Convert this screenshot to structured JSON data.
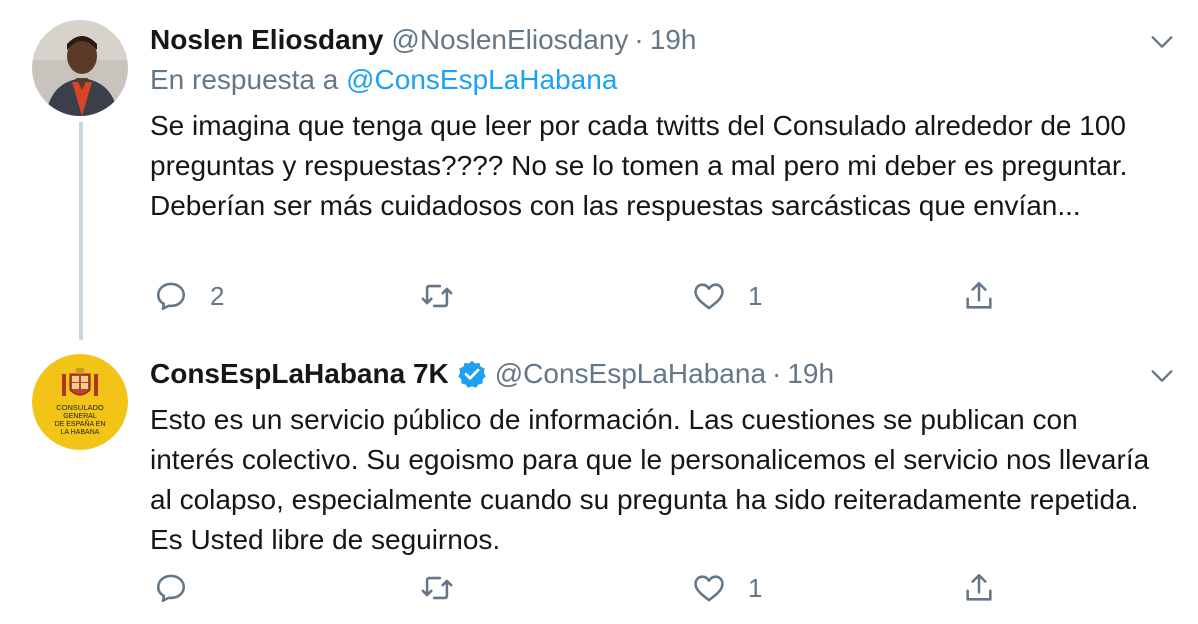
{
  "tweets": [
    {
      "name": "Noslen Eliosdany",
      "handle": "@NoslenEliosdany",
      "separator": "·",
      "time": "19h",
      "reply_prefix": "En respuesta a",
      "reply_mention": "@ConsEspLaHabana",
      "text": "Se imagina que tenga que leer por cada twitts del Consulado alrededor de 100 preguntas y respuestas???? No se lo tomen a mal pero mi deber es preguntar. Deberían ser más cuidadosos con las respuestas sarcásticas que envían...",
      "replies": "2",
      "retweets": "",
      "likes": "1",
      "avatar_icon": "user-photo-avatar"
    },
    {
      "name": "ConsEspLaHabana 7K",
      "handle": "@ConsEspLaHabana",
      "separator": "·",
      "time": "19h",
      "verified": true,
      "text": "Esto es un servicio público de información. Las cuestiones se publican con interés colectivo. Su egoismo para que le personalicemos el servicio nos llevaría al colapso, especialmente cuando su pregunta ha sido reiteradamente repetida. Es Usted libre de seguirnos.",
      "replies": "",
      "retweets": "",
      "likes": "1",
      "avatar_icon": "consulate-logo-avatar",
      "avatar_logo_lines": [
        "CONSULADO",
        "GENERAL",
        "DE ESPAÑA EN",
        "LA HABANA"
      ]
    }
  ],
  "colors": {
    "text": "#14171a",
    "secondary": "#657786",
    "link": "#1da1f2",
    "thread_line": "#ccd6dd",
    "logo_yellow": "#f2c418"
  }
}
